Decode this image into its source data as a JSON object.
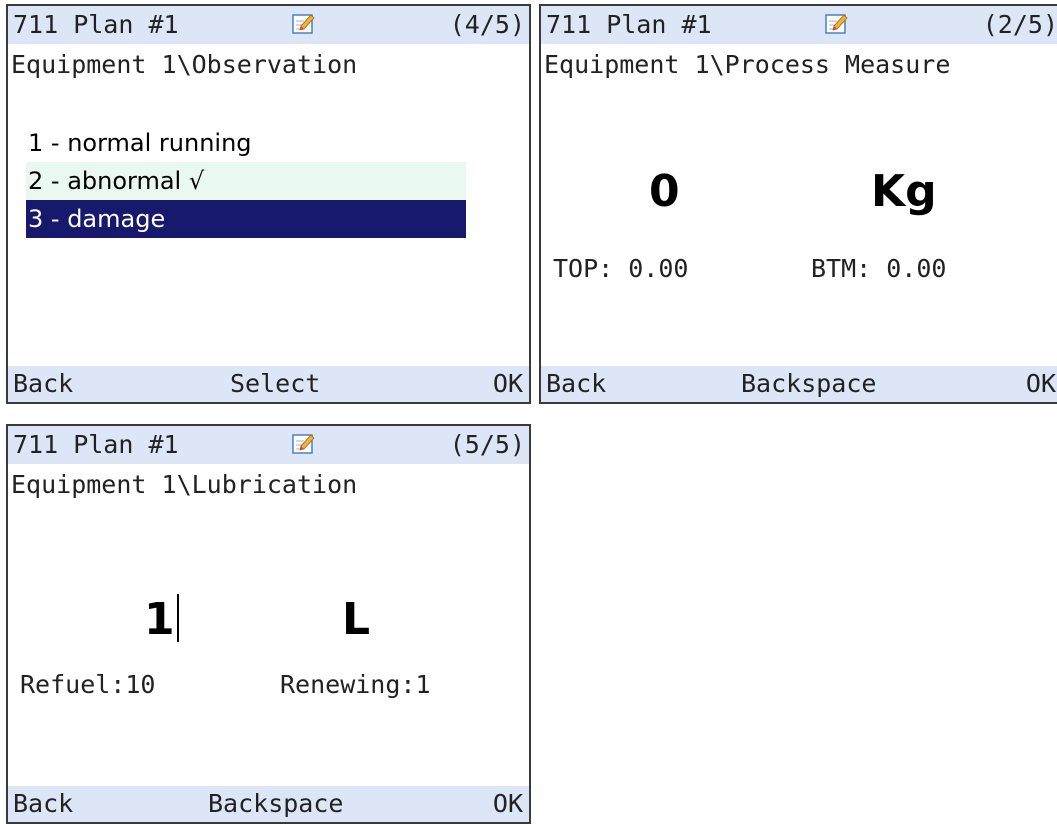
{
  "screens": [
    {
      "title": "711 Plan #1",
      "counter": "(4/5)",
      "path": "Equipment 1\\Observation",
      "options": [
        {
          "label": "1 - normal running",
          "state": "normal"
        },
        {
          "label": "2 - abnormal √",
          "state": "checked"
        },
        {
          "label": "3 - damage",
          "state": "selected"
        }
      ],
      "softkeys": {
        "left": "Back",
        "center": "Select",
        "right": "OK"
      }
    },
    {
      "title": "711 Plan #1",
      "counter": "(2/5)",
      "path": "Equipment 1\\Process Measure",
      "value": "0",
      "unit": "Kg",
      "limits": {
        "top": "TOP: 0.00",
        "btm": "BTM: 0.00"
      },
      "softkeys": {
        "left": "Back",
        "center": "Backspace",
        "right": "OK"
      }
    },
    {
      "title": "711 Plan #1",
      "counter": "(5/5)",
      "path": "Equipment 1\\Lubrication",
      "value": "1",
      "unit": "L",
      "info": {
        "refuel": "Refuel:10",
        "renewing": "Renewing:1"
      },
      "softkeys": {
        "left": "Back",
        "center": "Backspace",
        "right": "OK"
      }
    }
  ],
  "colors": {
    "bar_background": "#dde6f6",
    "selected_background": "#17196d",
    "checked_background": "#eaf8f2",
    "border": "#3a3a3a"
  },
  "icons": {
    "title_icon": "edit-note-icon"
  }
}
